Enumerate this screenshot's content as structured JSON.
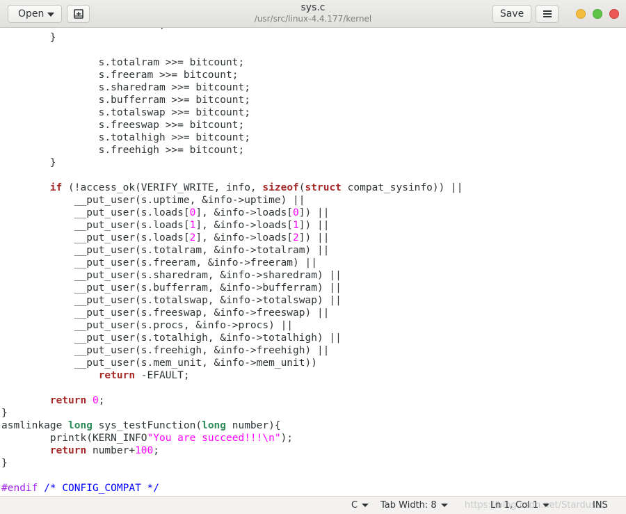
{
  "header": {
    "open_label": "Open",
    "save_label": "Save",
    "title": "sys.c",
    "subtitle": "/usr/src/linux-4.4.177/kernel"
  },
  "editor": {
    "lines": [
      [
        [
          "                bitcount++;",
          ""
        ]
      ],
      [
        [
          "        }",
          ""
        ]
      ],
      [
        [
          "",
          ""
        ]
      ],
      [
        [
          "                s.totalram >>= bitcount;",
          ""
        ]
      ],
      [
        [
          "                s.freeram >>= bitcount;",
          ""
        ]
      ],
      [
        [
          "                s.sharedram >>= bitcount;",
          ""
        ]
      ],
      [
        [
          "                s.bufferram >>= bitcount;",
          ""
        ]
      ],
      [
        [
          "                s.totalswap >>= bitcount;",
          ""
        ]
      ],
      [
        [
          "                s.freeswap >>= bitcount;",
          ""
        ]
      ],
      [
        [
          "                s.totalhigh >>= bitcount;",
          ""
        ]
      ],
      [
        [
          "                s.freehigh >>= bitcount;",
          ""
        ]
      ],
      [
        [
          "        }",
          ""
        ]
      ],
      [
        [
          "",
          ""
        ]
      ],
      [
        [
          "        ",
          ""
        ],
        [
          "if",
          "kw"
        ],
        [
          " (!access_ok(VERIFY_WRITE, info, ",
          ""
        ],
        [
          "sizeof",
          "kw"
        ],
        [
          "(",
          ""
        ],
        [
          "struct",
          "kw"
        ],
        [
          " compat_sysinfo)) ||",
          ""
        ]
      ],
      [
        [
          "            __put_user(s.uptime, &info->uptime) ||",
          ""
        ]
      ],
      [
        [
          "            __put_user(s.loads[",
          ""
        ],
        [
          "0",
          "num"
        ],
        [
          "], &info->loads[",
          ""
        ],
        [
          "0",
          "num"
        ],
        [
          "]) ||",
          ""
        ]
      ],
      [
        [
          "            __put_user(s.loads[",
          ""
        ],
        [
          "1",
          "num"
        ],
        [
          "], &info->loads[",
          ""
        ],
        [
          "1",
          "num"
        ],
        [
          "]) ||",
          ""
        ]
      ],
      [
        [
          "            __put_user(s.loads[",
          ""
        ],
        [
          "2",
          "num"
        ],
        [
          "], &info->loads[",
          ""
        ],
        [
          "2",
          "num"
        ],
        [
          "]) ||",
          ""
        ]
      ],
      [
        [
          "            __put_user(s.totalram, &info->totalram) ||",
          ""
        ]
      ],
      [
        [
          "            __put_user(s.freeram, &info->freeram) ||",
          ""
        ]
      ],
      [
        [
          "            __put_user(s.sharedram, &info->sharedram) ||",
          ""
        ]
      ],
      [
        [
          "            __put_user(s.bufferram, &info->bufferram) ||",
          ""
        ]
      ],
      [
        [
          "            __put_user(s.totalswap, &info->totalswap) ||",
          ""
        ]
      ],
      [
        [
          "            __put_user(s.freeswap, &info->freeswap) ||",
          ""
        ]
      ],
      [
        [
          "            __put_user(s.procs, &info->procs) ||",
          ""
        ]
      ],
      [
        [
          "            __put_user(s.totalhigh, &info->totalhigh) ||",
          ""
        ]
      ],
      [
        [
          "            __put_user(s.freehigh, &info->freehigh) ||",
          ""
        ]
      ],
      [
        [
          "            __put_user(s.mem_unit, &info->mem_unit))",
          ""
        ]
      ],
      [
        [
          "                ",
          ""
        ],
        [
          "return",
          "kw"
        ],
        [
          " -EFAULT;",
          ""
        ]
      ],
      [
        [
          "",
          ""
        ]
      ],
      [
        [
          "        ",
          ""
        ],
        [
          "return",
          "kw"
        ],
        [
          " ",
          ""
        ],
        [
          "0",
          "num"
        ],
        [
          ";",
          ""
        ]
      ],
      [
        [
          "}",
          ""
        ]
      ],
      [
        [
          "asmlinkage ",
          ""
        ],
        [
          "long",
          "ty"
        ],
        [
          " sys_testFunction(",
          ""
        ],
        [
          "long",
          "ty"
        ],
        [
          " number){",
          ""
        ]
      ],
      [
        [
          "        printk(KERN_INFO",
          ""
        ],
        [
          "\"You are succeed!!!\\n\"",
          "str"
        ],
        [
          ");",
          ""
        ]
      ],
      [
        [
          "        ",
          ""
        ],
        [
          "return",
          "kw"
        ],
        [
          " number+",
          ""
        ],
        [
          "100",
          "num"
        ],
        [
          ";",
          ""
        ]
      ],
      [
        [
          "}",
          ""
        ]
      ],
      [
        [
          "",
          ""
        ]
      ],
      [
        [
          "#endif",
          "pp"
        ],
        [
          " ",
          ""
        ],
        [
          "/* CONFIG_COMPAT */",
          "cm"
        ]
      ]
    ]
  },
  "statusbar": {
    "language": "C",
    "tab_width": "Tab Width: 8",
    "position": "Ln 1, Col 1",
    "mode": "INS",
    "watermark": "https://blog.csdn.net/Stardust..."
  },
  "icons": {
    "open_caret": "chevron-down-icon",
    "new_tab": "new-document-icon",
    "menu": "hamburger-menu-icon",
    "minimize": "minimize-icon",
    "maximize": "maximize-icon",
    "close": "close-icon"
  },
  "colors": {
    "keyword": "#a52a2a",
    "type": "#2e8b57",
    "number": "#ff00ff",
    "preprocessor": "#a020f0",
    "comment": "#0000ff"
  }
}
